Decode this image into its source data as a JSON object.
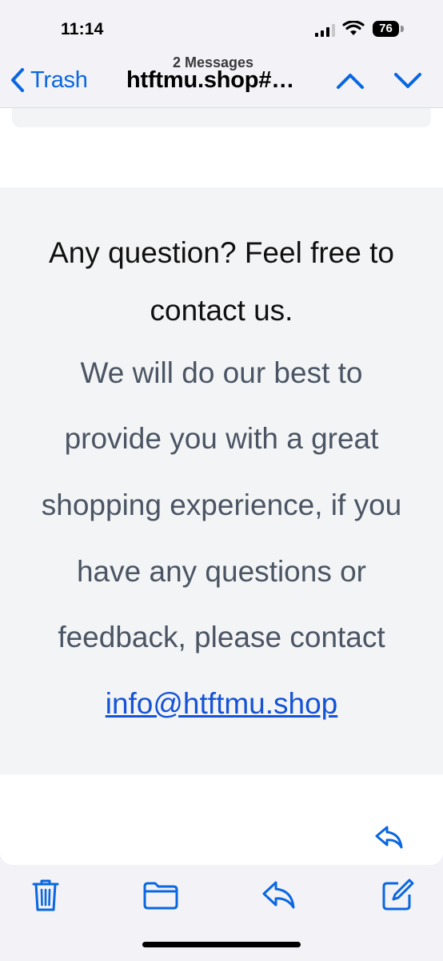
{
  "status_bar": {
    "time": "11:14",
    "battery": "76"
  },
  "nav": {
    "back_label": "Trash",
    "message_count": "2 Messages",
    "subject": "htftmu.shop#…"
  },
  "email": {
    "contact_heading_line1": "Any question? Feel free to",
    "contact_heading_line2": "contact us.",
    "body_lines": [
      "We will do our best to",
      "provide you with a great",
      "shopping experience, if you",
      "have any questions or",
      "feedback, please contact"
    ],
    "email_link": "info@htftmu.shop"
  },
  "toolbar": {
    "icons": [
      "trash-icon",
      "folder-icon",
      "reply-icon",
      "compose-icon"
    ]
  },
  "colors": {
    "accent": "#0a67e0",
    "link": "#1553d6",
    "body_text": "#4b5563"
  }
}
